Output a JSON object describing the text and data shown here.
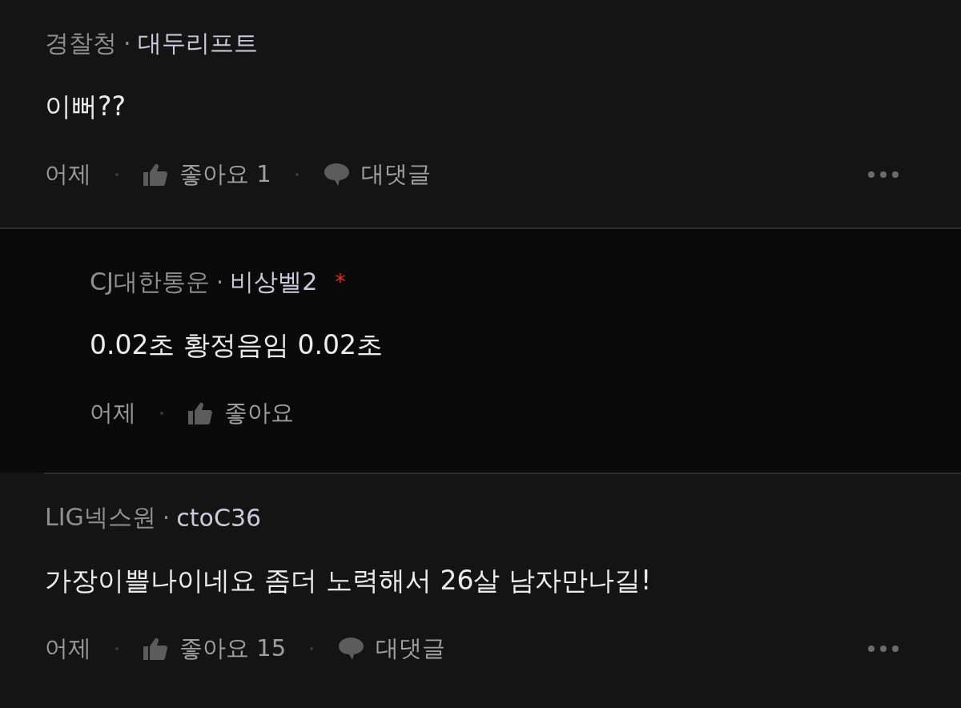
{
  "comments": [
    {
      "kind": "comment",
      "company": "경찰청",
      "separator": "·",
      "nickname": "대두리프트",
      "body": "이뻐??",
      "time": "어제",
      "like_label": "좋아요 1",
      "reply_label": "대댓글"
    },
    {
      "kind": "reply",
      "company": "CJ대한통운",
      "separator": "·",
      "nickname": "비상벨2",
      "badge": "*",
      "body": "0.02초 황정음임 0.02초",
      "time": "어제",
      "like_label": "좋아요"
    },
    {
      "kind": "comment",
      "company": "LIG넥스원",
      "separator": "·",
      "nickname": "ctoC36",
      "body": "가장이쁠나이네요 좀더 노력해서 26살 남자만나길!",
      "time": "어제",
      "like_label": "좋아요 15",
      "reply_label": "대댓글"
    }
  ]
}
